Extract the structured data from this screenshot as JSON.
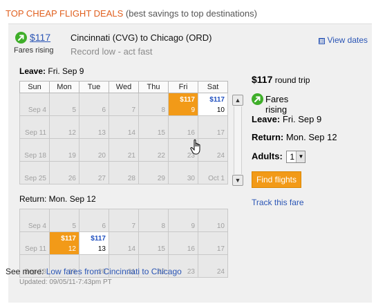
{
  "header": {
    "title": "TOP CHEAP FLIGHT DEALS",
    "subtitle": "(best savings to top destinations)"
  },
  "deal": {
    "price": "$117",
    "fares_status": "Fares rising",
    "route": "Cincinnati (CVG) to Chicago (ORD)",
    "note": "Record low - act fast",
    "view_dates": "View dates",
    "view_dates_icon": "⊟"
  },
  "leave_cal": {
    "label_bold": "Leave:",
    "label_value": "Fri. Sep 9",
    "days": [
      "Sun",
      "Mon",
      "Tue",
      "Wed",
      "Thu",
      "Fri",
      "Sat"
    ],
    "weeks": [
      [
        "Sep 4",
        "5",
        "6",
        "7",
        "8",
        "9",
        "10"
      ],
      [
        "Sep 11",
        "12",
        "13",
        "14",
        "15",
        "16",
        "17"
      ],
      [
        "Sep 18",
        "19",
        "20",
        "21",
        "22",
        "23",
        "24"
      ],
      [
        "Sep 25",
        "26",
        "27",
        "28",
        "29",
        "30",
        "Oct 1"
      ]
    ],
    "price_fri": "$117",
    "price_sat": "$117"
  },
  "return_cal": {
    "label": "Return: Mon. Sep 12",
    "weeks": [
      [
        "Sep 4",
        "5",
        "6",
        "7",
        "8",
        "9",
        "10"
      ],
      [
        "Sep 11",
        "12",
        "13",
        "14",
        "15",
        "16",
        "17"
      ],
      [
        "Sep 18",
        "19",
        "20",
        "21",
        "22",
        "23",
        "24"
      ]
    ],
    "price_mon": "$117",
    "price_tue": "$117"
  },
  "summary": {
    "price": "$117",
    "trip_type": "round trip",
    "fares_status": "Fares rising",
    "leave_label": "Leave:",
    "leave_value": "Fri. Sep 9",
    "return_label": "Return:",
    "return_value": "Mon. Sep 12",
    "adults_label": "Adults:",
    "adults_value": "1",
    "find_button": "Find flights",
    "track_link": "Track this fare"
  },
  "footer": {
    "updated": "Updated: 09/05/11-7:43pm PT",
    "see_more": "See more:",
    "see_more_link": "Low fares from Cincinnati to Chicago"
  },
  "colors": {
    "accent_orange": "#f29a18",
    "link_blue": "#2a55b5",
    "rising_green": "#3fae2a",
    "header_orange": "#e0601f"
  }
}
